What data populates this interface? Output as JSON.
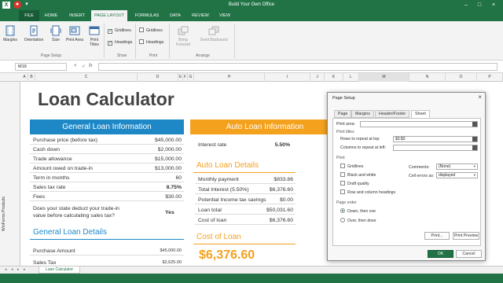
{
  "window": {
    "title": "Build Your Own Office"
  },
  "tabs": [
    {
      "label": "FILE"
    },
    {
      "label": "HOME"
    },
    {
      "label": "INSERT"
    },
    {
      "label": "PAGE LAYOUT"
    },
    {
      "label": "FORMULAS"
    },
    {
      "label": "DATA"
    },
    {
      "label": "REVIEW"
    },
    {
      "label": "VIEW"
    }
  ],
  "ribbon": {
    "margins": "Margins",
    "orientation": "Orientation",
    "size": "Size",
    "print_area": "Print Area",
    "print_titles": "Print Titles",
    "page_setup_group": "Page Setup",
    "gridlines": "Gridlines",
    "headings": "Headings",
    "show_group": "Show",
    "print_gridlines": "Gridlines",
    "print_headings": "Headings",
    "print_group": "Print",
    "bring_forward": "Bring Forward",
    "send_backward": "Send Backward",
    "arrange_group": "Arrange"
  },
  "formula_bar": {
    "name_box": "M19",
    "cancel": "×",
    "enter": "✓",
    "fx": "fx"
  },
  "columns": [
    "A",
    "B",
    "C",
    "D",
    "E",
    "F",
    "G",
    "H",
    "I",
    "J",
    "K",
    "L",
    "M",
    "N",
    "O",
    "P"
  ],
  "side_label": "WinForms Products",
  "sheet": {
    "title": "Loan Calculator",
    "general_header": "General Loan Information",
    "general_rows": [
      {
        "label": "Purchase price (before tax)",
        "value": "$45,000.00"
      },
      {
        "label": "Cash down",
        "value": "$2,000.00"
      },
      {
        "label": "Trade allowance",
        "value": "$15,000.00"
      },
      {
        "label": "Amount owed on trade-in",
        "value": "$13,000.00"
      },
      {
        "label": "Term in months",
        "value": "60"
      },
      {
        "label": "Sales tax rate",
        "value": "8.75%"
      },
      {
        "label": "Fees",
        "value": "$30.00"
      }
    ],
    "question_line1": "Does your state deduct your trade-in",
    "question_line2": "value before calculating sales tax?",
    "question_answer": "Yes",
    "general_details_title": "General Loan Details",
    "general_details_rows": [
      {
        "label": "Purchase Amount",
        "value": "$45,000.00"
      },
      {
        "label": "Sales Tax",
        "value": "$2,625.00"
      }
    ],
    "auto_header": "Auto Loan Information",
    "interest_label": "Interest rate",
    "interest_value": "5.50%",
    "auto_details_title": "Auto Loan Details",
    "auto_details_rows": [
      {
        "label": "Monthly payment",
        "value": "$833.86"
      },
      {
        "label": "Total Interest (5.50%)",
        "value": "$6,376.60"
      },
      {
        "label": "Potential Income tax savings",
        "value": "$0.00"
      },
      {
        "label": "Loan total",
        "value": "$50,031.60"
      },
      {
        "label": "Cost of loan",
        "value": "$6,376.60"
      }
    ],
    "cost_title": "Cost of Loan",
    "cost_value": "$6,376.60"
  },
  "sheet_tab": "Loan Calculator",
  "dialog": {
    "title": "Page Setup",
    "close": "×",
    "tabs": [
      "Page",
      "Margins",
      "Header/Footer",
      "Sheet"
    ],
    "print_area_label": "Print area:",
    "print_titles_section": "Print titles",
    "rows_repeat_label": "Rows to repeat at top:",
    "rows_repeat_value": "$3:$3",
    "cols_repeat_label": "Columns to repeat at left:",
    "print_section": "Print",
    "gridlines": "Gridlines",
    "black_white": "Black and white",
    "draft_quality": "Draft quality",
    "row_col_headings": "Row and column headings",
    "comments_label": "Comments:",
    "comments_value": "(None)",
    "cell_errors_label": "Cell errors as:",
    "cell_errors_value": "displayed",
    "page_order_section": "Page order",
    "down_then_over": "Down, then ove",
    "over_then_down": "Over, then dowr",
    "print_button": "Print...",
    "preview_button": "Print Preview",
    "ok_button": "OK",
    "cancel_button": "Cancel"
  },
  "colors": {
    "excel_green": "#217346",
    "blue": "#1e88c7",
    "orange": "#f4a11d"
  }
}
